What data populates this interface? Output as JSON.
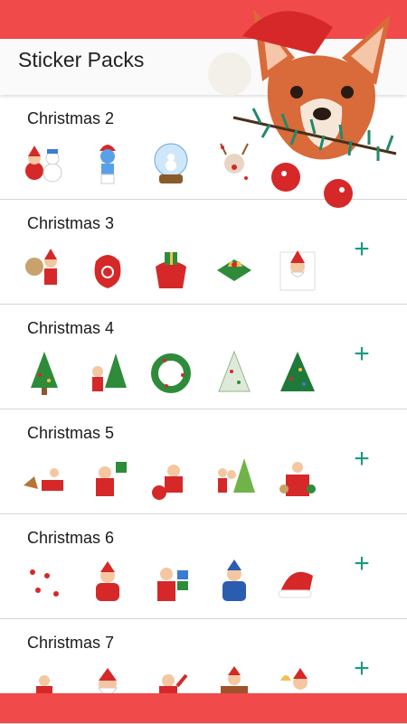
{
  "app": {
    "title": "Sticker Packs"
  },
  "packs": [
    {
      "name": "Christmas 2",
      "stickers": [
        "santa-snowman-sticker",
        "smurf-sticker",
        "snow-globe-sticker",
        "reindeer-sticker"
      ],
      "show_add": false
    },
    {
      "name": "Christmas 3",
      "stickers": [
        "santa-gift-bag-sticker",
        "red-sack-sticker",
        "gift-bag-sticker",
        "bells-sticker",
        "santa-peek-sticker"
      ],
      "show_add": true
    },
    {
      "name": "Christmas 4",
      "stickers": [
        "christmas-tree-sticker",
        "santa-tree-sticker",
        "wreath-sticker",
        "white-tree-sticker",
        "decorated-tree-sticker"
      ],
      "show_add": true
    },
    {
      "name": "Christmas 5",
      "stickers": [
        "sleigh-sticker",
        "santa-gift-sticker",
        "santa-sitting-sticker",
        "kids-tree-sticker",
        "santa-group-sticker"
      ],
      "show_add": true
    },
    {
      "name": "Christmas 6",
      "stickers": [
        "pattern-sticker",
        "santa-arms-sticker",
        "santa-presents-sticker",
        "blue-santa-sticker",
        "santa-hat-sticker"
      ],
      "show_add": true
    },
    {
      "name": "Christmas 7",
      "stickers": [
        "santa-small-sticker",
        "santa-face-sticker",
        "santa-wave-sticker",
        "chimney-sticker",
        "santa-bell-sticker"
      ],
      "show_add": true
    }
  ],
  "add_symbol": "+",
  "colors": {
    "status_bar": "#f04a4a",
    "accent": "#1b9a82",
    "title": "#222222"
  },
  "mascot": {
    "icon": "corgi-santa-hat-icon"
  }
}
